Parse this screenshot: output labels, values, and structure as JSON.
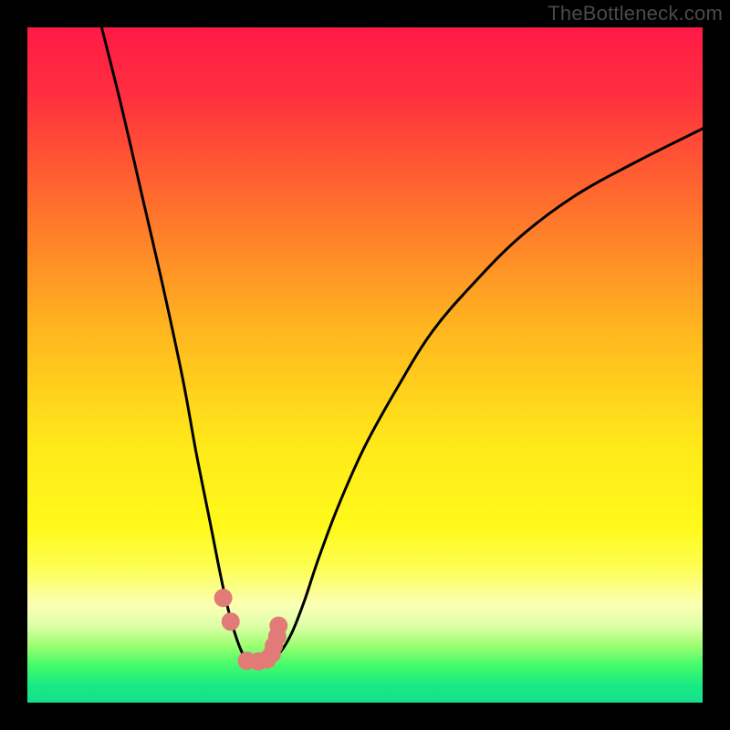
{
  "watermark": "TheBottleneck.com",
  "colors": {
    "gradient_stops": [
      {
        "offset": 0.0,
        "color": "#ff1a46"
      },
      {
        "offset": 0.1,
        "color": "#ff2f3f"
      },
      {
        "offset": 0.25,
        "color": "#ff6a2e"
      },
      {
        "offset": 0.45,
        "color": "#ffb71f"
      },
      {
        "offset": 0.62,
        "color": "#ffe919"
      },
      {
        "offset": 0.74,
        "color": "#fff91a"
      },
      {
        "offset": 0.8,
        "color": "#fdff52"
      },
      {
        "offset": 0.855,
        "color": "#fbffb4"
      },
      {
        "offset": 0.885,
        "color": "#e0ffa9"
      },
      {
        "offset": 0.915,
        "color": "#9eff72"
      },
      {
        "offset": 0.945,
        "color": "#43fb6a"
      },
      {
        "offset": 0.975,
        "color": "#18e985"
      },
      {
        "offset": 1.0,
        "color": "#17df8c"
      }
    ],
    "curve": "#000000",
    "marker_fill": "#e27b78",
    "marker_stroke": "#a84f4d"
  },
  "chart_data": {
    "type": "line",
    "title": "",
    "xlabel": "",
    "ylabel": "",
    "xlim": [
      0,
      100
    ],
    "ylim": [
      0,
      100
    ],
    "note": "Axes are unlabeled in the image; values are normalized 0–100 from the plot rectangle. y=0 at bottom, y=100 at top.",
    "series": [
      {
        "name": "bottleneck-curve",
        "x": [
          11.0,
          14.0,
          17.0,
          20.0,
          23.0,
          25.0,
          27.0,
          29.0,
          30.5,
          32.0,
          33.0,
          34.0,
          35.0,
          37.0,
          39.0,
          41.0,
          43.0,
          46.0,
          50.0,
          55.0,
          60.0,
          66.0,
          73.0,
          81.0,
          90.0,
          100.0
        ],
        "y": [
          100.0,
          88.0,
          75.0,
          62.0,
          48.0,
          37.0,
          27.0,
          17.0,
          11.0,
          7.0,
          6.3,
          6.1,
          6.3,
          7.0,
          10.0,
          15.0,
          21.0,
          29.0,
          38.0,
          47.0,
          55.0,
          62.0,
          69.0,
          75.0,
          80.0,
          85.0
        ]
      }
    ],
    "markers": {
      "name": "highlighted-points",
      "x": [
        29.0,
        30.1,
        32.5,
        34.2,
        35.5,
        36.2,
        36.5,
        37.0,
        37.2
      ],
      "y": [
        15.5,
        12.0,
        6.2,
        6.1,
        6.4,
        7.2,
        8.4,
        9.8,
        11.4
      ]
    }
  }
}
